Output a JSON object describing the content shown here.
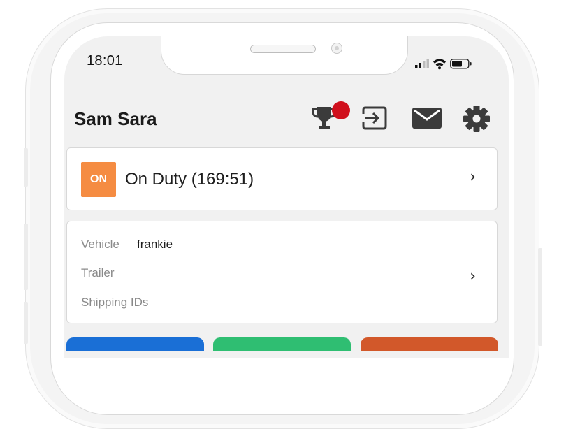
{
  "status_bar": {
    "time": "18:01"
  },
  "header": {
    "driver_name": "Sam Sara",
    "icons": [
      "trophy-icon",
      "logout-icon",
      "mail-icon",
      "settings-gear-icon"
    ]
  },
  "duty_status": {
    "badge": "ON",
    "label": "On Duty (169:51)",
    "badge_color": "#f58c42"
  },
  "assignments": {
    "vehicle_label": "Vehicle",
    "vehicle_value": "frankie",
    "trailer_label": "Trailer",
    "shipping_label": "Shipping IDs"
  },
  "chevron": "›",
  "action_buttons": [
    {
      "name": "blue-action",
      "color": "#1a6fd6"
    },
    {
      "name": "green-action",
      "color": "#2fbe72"
    },
    {
      "name": "orange-action",
      "color": "#d2582a"
    }
  ],
  "colors": {
    "notification": "#d0101d",
    "screen_bg": "#f1f1f1"
  }
}
